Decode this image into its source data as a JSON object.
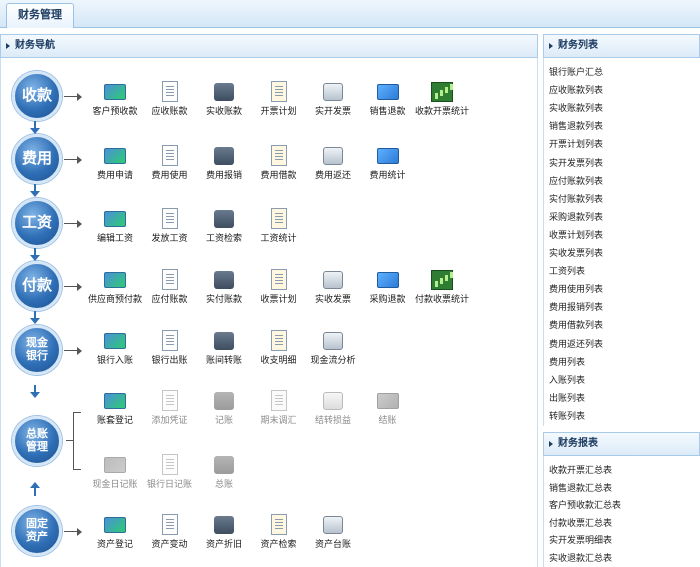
{
  "top_tab": "财务管理",
  "nav_title": "财务导航",
  "list_title": "财务列表",
  "report_title": "财务报表",
  "categories": {
    "shoukuan": "收款",
    "feiyong": "费用",
    "gongzi": "工资",
    "fukuan": "付款",
    "xianjin": "现金\n银行",
    "zongzhang": "总账\n管理",
    "guding": "固定\n资产"
  },
  "rows": {
    "shoukuan": [
      "客户预收款",
      "应收账款",
      "实收账款",
      "开票计划",
      "实开发票",
      "销售退款",
      "收款开票统计"
    ],
    "feiyong": [
      "费用申请",
      "费用使用",
      "费用报销",
      "费用借款",
      "费用返还",
      "费用统计"
    ],
    "gongzi": [
      "编辑工资",
      "发放工资",
      "工资检索",
      "工资统计"
    ],
    "fukuan": [
      "供应商预付款",
      "应付账款",
      "实付账款",
      "收票计划",
      "实收发票",
      "采购退款",
      "付款收票统计"
    ],
    "xianjin": [
      "银行入账",
      "银行出账",
      "账间转账",
      "收支明细",
      "现金流分析"
    ],
    "zongzhang_top": [
      "账套登记",
      "添加凭证",
      "记账",
      "期末调汇",
      "结转损益",
      "结账"
    ],
    "zongzhang_bottom": [
      "现金日记账",
      "银行日记账",
      "总账"
    ],
    "guding": [
      "资产登记",
      "资产变动",
      "资产折旧",
      "资产检索",
      "资产台账"
    ]
  },
  "list_items": [
    "银行账户汇总",
    "应收账款列表",
    "实收账款列表",
    "销售退款列表",
    "开票计划列表",
    "实开发票列表",
    "应付账款列表",
    "实付账款列表",
    "采购退款列表",
    "收票计划列表",
    "实收发票列表",
    "工资列表",
    "费用使用列表",
    "费用报销列表",
    "费用借款列表",
    "费用返还列表",
    "费用列表",
    "入账列表",
    "出账列表",
    "转账列表"
  ],
  "report_items": [
    "收款开票汇总表",
    "销售退款汇总表",
    "客户预收款汇总表",
    "付款收票汇总表",
    "实开发票明细表",
    "实收退款汇总表"
  ],
  "colors": {
    "circle": "#2f6fb6",
    "panel_border": "#a9cbea",
    "header_text": "#1e3d62"
  }
}
